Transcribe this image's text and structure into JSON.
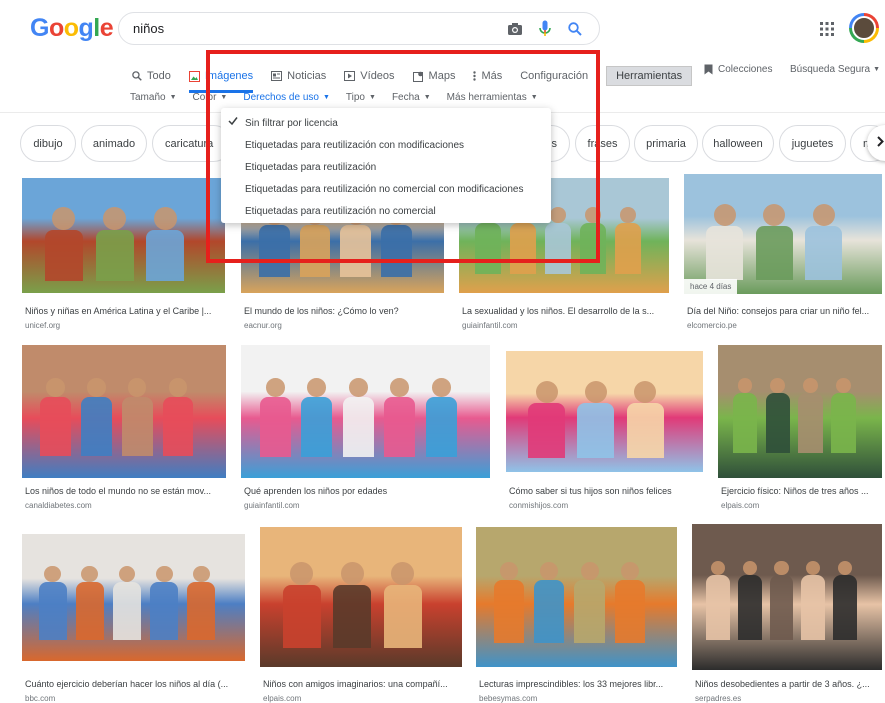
{
  "header": {
    "logo_letters": [
      {
        "ch": "G",
        "color": "#4285f4"
      },
      {
        "ch": "o",
        "color": "#ea4335"
      },
      {
        "ch": "o",
        "color": "#fbbc05"
      },
      {
        "ch": "g",
        "color": "#4285f4"
      },
      {
        "ch": "l",
        "color": "#34a853"
      },
      {
        "ch": "e",
        "color": "#ea4335"
      }
    ],
    "query": "niños",
    "icons": [
      "camera-icon",
      "microphone-icon",
      "search-icon",
      "apps-icon"
    ]
  },
  "tabs": [
    {
      "label": "Todo",
      "icon": "search-icon",
      "active": false
    },
    {
      "label": "Imágenes",
      "icon": "image-icon",
      "active": true
    },
    {
      "label": "Noticias",
      "icon": "news-icon",
      "active": false
    },
    {
      "label": "Vídeos",
      "icon": "video-icon",
      "active": false
    },
    {
      "label": "Maps",
      "icon": "map-icon",
      "active": false
    },
    {
      "label": "Más",
      "icon": "more-vert-icon",
      "active": false
    },
    {
      "label": "Configuración",
      "icon": "",
      "active": false
    },
    {
      "label": "Herramientas",
      "icon": "",
      "active": false,
      "tools": true
    }
  ],
  "right_links": {
    "collections": "Colecciones",
    "safe_search": "Búsqueda Segura"
  },
  "filters": [
    {
      "label": "Tamaño",
      "active": false
    },
    {
      "label": "Color",
      "active": false
    },
    {
      "label": "Derechos de uso",
      "active": true
    },
    {
      "label": "Tipo",
      "active": false
    },
    {
      "label": "Fecha",
      "active": false
    },
    {
      "label": "Más herramientas",
      "active": false
    }
  ],
  "chips": [
    "dibujo",
    "animado",
    "caricatura",
    "frases",
    "primaria",
    "halloween",
    "juguetes",
    "m"
  ],
  "dropdown": [
    {
      "label": "Sin filtrar por licencia",
      "checked": true
    },
    {
      "label": "Etiquetadas para reutilización con modificaciones",
      "checked": false
    },
    {
      "label": "Etiquetadas para reutilización",
      "checked": false
    },
    {
      "label": "Etiquetadas para reutilización no comercial con modificaciones",
      "checked": false
    },
    {
      "label": "Etiquetadas para reutilización no comercial",
      "checked": false
    }
  ],
  "results": [
    {
      "title": "Niños y niñas en América Latina y el Caribe |...",
      "source": "unicef.org",
      "colors": [
        "#6ba5d8",
        "#b2472b",
        "#7aa04a"
      ]
    },
    {
      "title": "El mundo de los niños: ¿Cómo lo ven?",
      "source": "eacnur.org",
      "colors": [
        "#e8c39a",
        "#3b6fa8",
        "#d9a35b"
      ]
    },
    {
      "title": "La sexualidad y los niños. El desarrollo de la s...",
      "source": "guiainfantil.com",
      "colors": [
        "#a9c7d6",
        "#6fb35a",
        "#e0a04c"
      ]
    },
    {
      "title": "Día del Niño: consejos para criar un niño fel...",
      "source": "elcomercio.pe",
      "colors": [
        "#9cc2dd",
        "#e7e3da",
        "#6a9b5c"
      ],
      "badge": "hace 4 días"
    },
    {
      "title": "Los niños de todo el mundo no se están mov...",
      "source": "canaldiabetes.com",
      "colors": [
        "#c08b6b",
        "#e74c5a",
        "#3f7ec2"
      ]
    },
    {
      "title": "Qué aprenden los niños por edades",
      "source": "guiainfantil.com",
      "colors": [
        "#f2f2f2",
        "#e85a8f",
        "#3aa0d8"
      ]
    },
    {
      "title": "Cómo saber si tus hijos son niños felices",
      "source": "conmishijos.com",
      "colors": [
        "#f6d6a8",
        "#e13a78",
        "#8fc3e8"
      ]
    },
    {
      "title": "Ejercicio físico: Niños de tres años ...",
      "source": "elpais.com",
      "colors": [
        "#a68e6f",
        "#7ab54b",
        "#2f4f3a"
      ]
    },
    {
      "title": "Cuánto ejercicio deberían hacer los niños al día (...",
      "source": "bbc.com",
      "colors": [
        "#e6e3df",
        "#4d7fc4",
        "#d9682d"
      ]
    },
    {
      "title": "Niños con amigos imaginarios: una compañí...",
      "source": "elpais.com",
      "colors": [
        "#e8b57a",
        "#c9412e",
        "#5a3a2a"
      ]
    },
    {
      "title": "Lecturas imprescindibles: los 33 mejores libr...",
      "source": "bebesymas.com",
      "colors": [
        "#b7a76d",
        "#e67a2c",
        "#3f93c9"
      ]
    },
    {
      "title": "Niños desobedientes a partir de 3 años. ¿...",
      "source": "serpadres.es",
      "colors": [
        "#6e5a4e",
        "#e7c3a6",
        "#2c2c2c"
      ]
    }
  ]
}
